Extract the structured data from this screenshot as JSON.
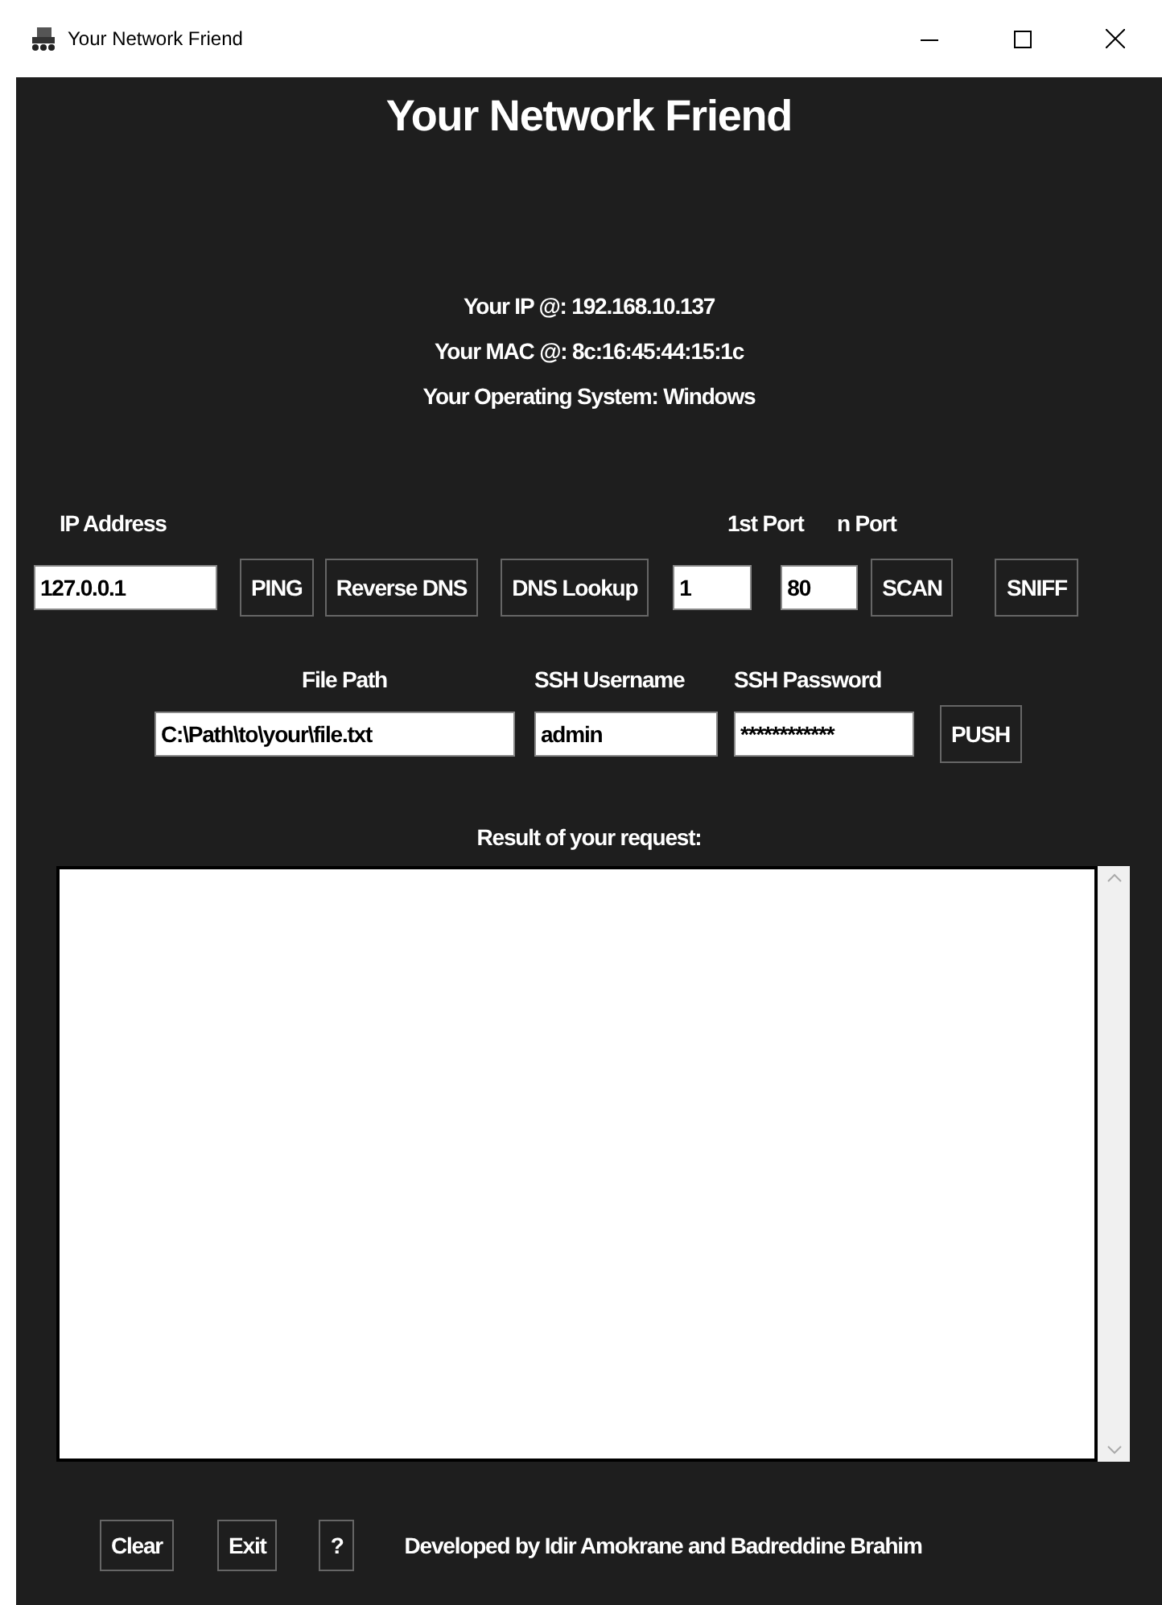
{
  "window": {
    "title": "Your Network Friend"
  },
  "heading": "Your Network Friend",
  "info": [
    "Your IP @: 192.168.10.137",
    "Your MAC @: 8c:16:45:44:15:1c",
    "Your Operating System: Windows"
  ],
  "row1": {
    "labels": [
      "IP Address",
      "1st Port",
      "n Port"
    ],
    "ip": {
      "value": "127.0.0.1"
    },
    "buttons_a": [
      "PING",
      "Reverse DNS",
      "DNS Lookup"
    ],
    "port_first": {
      "value": "1"
    },
    "port_n": {
      "value": "80"
    },
    "buttons_b": [
      "SCAN",
      "SNIFF"
    ]
  },
  "row2": {
    "labels": [
      "File Path",
      "SSH Username",
      "SSH Password"
    ],
    "file_path": {
      "value": "C:\\Path\\to\\your\\file.txt"
    },
    "ssh_username": {
      "value": "admin"
    },
    "ssh_password": {
      "value": "************"
    },
    "button": "PUSH"
  },
  "result": {
    "label": "Result of your request:"
  },
  "footer": {
    "buttons": [
      "Clear",
      "Exit",
      "?"
    ],
    "credit": "Developed by Idir Amokrane and Badreddine Brahim"
  }
}
